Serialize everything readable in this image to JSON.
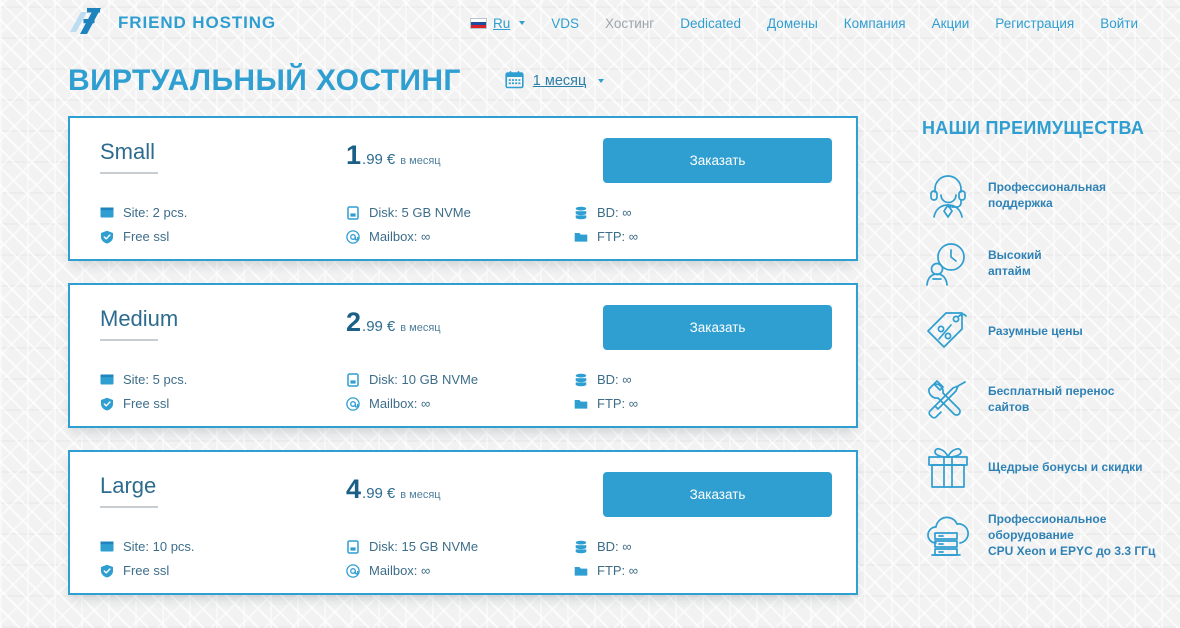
{
  "header": {
    "logo_text": "FRIEND HOSTING",
    "logo_icon": "friend-hosting-f-logo",
    "language": {
      "label": "Ru",
      "flag_icon": "russian-flag-icon",
      "caret_icon": "chevron-down-icon"
    },
    "nav": [
      {
        "label": "VDS",
        "active": false
      },
      {
        "label": "Хостинг",
        "active": true
      },
      {
        "label": "Dedicated",
        "active": false
      },
      {
        "label": "Домены",
        "active": false
      },
      {
        "label": "Компания",
        "active": false
      },
      {
        "label": "Акции",
        "active": false
      },
      {
        "label": "Регистрация",
        "active": false
      },
      {
        "label": "Войти",
        "active": false
      }
    ]
  },
  "page": {
    "title": "ВИРТУАЛЬНЫЙ ХОСТИНГ",
    "period": {
      "calendar_icon": "calendar-icon",
      "label": "1 месяц",
      "caret_icon": "chevron-down-icon"
    }
  },
  "plans": [
    {
      "name": "Small",
      "price_int": "1",
      "price_dec": ".99",
      "currency": "€",
      "per": "в месяц",
      "order_label": "Заказать",
      "features": {
        "site": "Site: 2 pcs.",
        "ssl": "Free ssl",
        "disk": "Disk: 5 GB NVMe",
        "mailbox": "Mailbox: ∞",
        "bd": "BD: ∞",
        "ftp": "FTP: ∞"
      }
    },
    {
      "name": "Medium",
      "price_int": "2",
      "price_dec": ".99",
      "currency": "€",
      "per": "в месяц",
      "order_label": "Заказать",
      "features": {
        "site": "Site: 5 pcs.",
        "ssl": "Free ssl",
        "disk": "Disk: 10 GB NVMe",
        "mailbox": "Mailbox: ∞",
        "bd": "BD: ∞",
        "ftp": "FTP: ∞"
      }
    },
    {
      "name": "Large",
      "price_int": "4",
      "price_dec": ".99",
      "currency": "€",
      "per": "в месяц",
      "order_label": "Заказать",
      "features": {
        "site": "Site: 10 pcs.",
        "ssl": "Free ssl",
        "disk": "Disk: 15 GB NVMe",
        "mailbox": "Mailbox: ∞",
        "bd": "BD: ∞",
        "ftp": "FTP: ∞"
      }
    }
  ],
  "advantages": {
    "title": "НАШИ ПРЕИМУЩЕСТВА",
    "items": [
      {
        "label": "Профессиональная\nподдержка",
        "icon": "support-agent-icon"
      },
      {
        "label": "Высокий\nаптайм",
        "icon": "uptime-clock-icon"
      },
      {
        "label": "Разумные цены",
        "icon": "price-tag-icon"
      },
      {
        "label": "Бесплатный перенос\nсайтов",
        "icon": "tools-wrench-screwdriver-icon"
      },
      {
        "label": "Щедрые бонусы и скидки",
        "icon": "gift-icon"
      },
      {
        "label": "Профессиональное оборудование\nCPU Xeon и EPYC до 3.3 ГГц",
        "icon": "cloud-server-icon"
      }
    ]
  },
  "feature_icons": {
    "site": "browser-window-icon",
    "ssl": "shield-check-icon",
    "disk": "disk-drive-icon",
    "mailbox": "at-sign-icon",
    "bd": "database-icon",
    "ftp": "folder-icon"
  },
  "colors": {
    "brand": "#2f9ed0",
    "text_blue": "#2d6c8f",
    "muted": "#9aa5ab",
    "background": "#f2f2f2"
  }
}
